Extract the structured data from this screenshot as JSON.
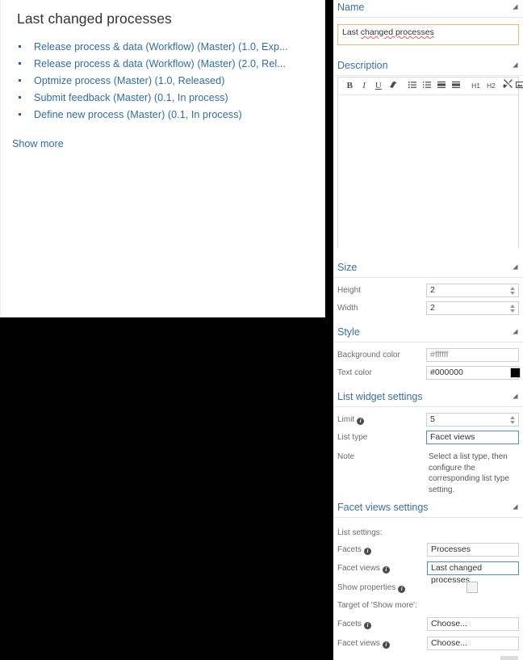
{
  "widget_preview": {
    "title": "Last changed processes",
    "items": [
      "Release process & data (Workflow) (Master) (1.0, Exp...",
      "Release process & data (Workflow) (Master) (2.0, Rel...",
      "Optmize process (Master) (1.0, Released)",
      "Submit feedback (Master) (0.1, In process)",
      "Define new process (Master) (0.1, In process)"
    ],
    "show_more_label": "Show more",
    "link_color": "#2e6da4",
    "title_color": "#333333"
  },
  "properties": {
    "name_section": {
      "header": "Name",
      "value": "Last changed processes",
      "spellcheck_part": "changed processes",
      "border_color": "#e8b87a"
    },
    "description_section": {
      "header": "Description",
      "body_text": "",
      "toolbar": [
        {
          "icon": "bold-icon",
          "label": "B"
        },
        {
          "icon": "italic-icon",
          "label": "I"
        },
        {
          "icon": "underline-icon",
          "label": "U"
        },
        {
          "icon": "remove-format-icon",
          "label": ""
        },
        {
          "icon": "bullet-list-icon",
          "label": ""
        },
        {
          "icon": "numbered-list-icon",
          "label": ""
        },
        {
          "icon": "outdent-icon",
          "label": ""
        },
        {
          "icon": "indent-icon",
          "label": ""
        },
        {
          "icon": "heading-1-icon",
          "label": "H1"
        },
        {
          "icon": "heading-2-icon",
          "label": "H2"
        },
        {
          "icon": "link-icon",
          "label": ""
        },
        {
          "icon": "image-icon",
          "label": ""
        }
      ],
      "expand_icon": "fullscreen-icon"
    },
    "size_section": {
      "header": "Size",
      "fields": [
        {
          "label": "Height",
          "value": "2"
        },
        {
          "label": "Width",
          "value": "2"
        }
      ]
    },
    "style_section": {
      "header": "Style",
      "fields": [
        {
          "label": "Background color",
          "value": "#ffffff"
        },
        {
          "label": "Text color",
          "value": "#000000",
          "swatch": "#000000"
        }
      ]
    },
    "list_widget_section": {
      "header": "List widget settings",
      "limit_label": "Limit",
      "limit_value": "5",
      "list_type_label": "List type",
      "list_type_value": "Facet views",
      "note_label": "Note",
      "note_value": "Select a list type, then configure the corresponding list type setting."
    },
    "facet_views_section": {
      "header": "Facet views settings",
      "list_settings_label": "List settings:",
      "facets_label": "Facets",
      "facets_value": "Processes",
      "facet_views_label": "Facet views",
      "facet_views_value": "Last changed processes",
      "show_properties_label": "Show properties",
      "show_properties_checked": false,
      "target_show_more_label": "Target of 'Show more':",
      "target_facets_label": "Facets",
      "target_facets_value": "Choose...",
      "target_facet_views_label": "Facet views",
      "target_facet_views_value": "Choose..."
    },
    "collapse_icon": "collapse-arrow-icon",
    "info_icon": "info-icon",
    "header_color": "#3a6ea5"
  }
}
